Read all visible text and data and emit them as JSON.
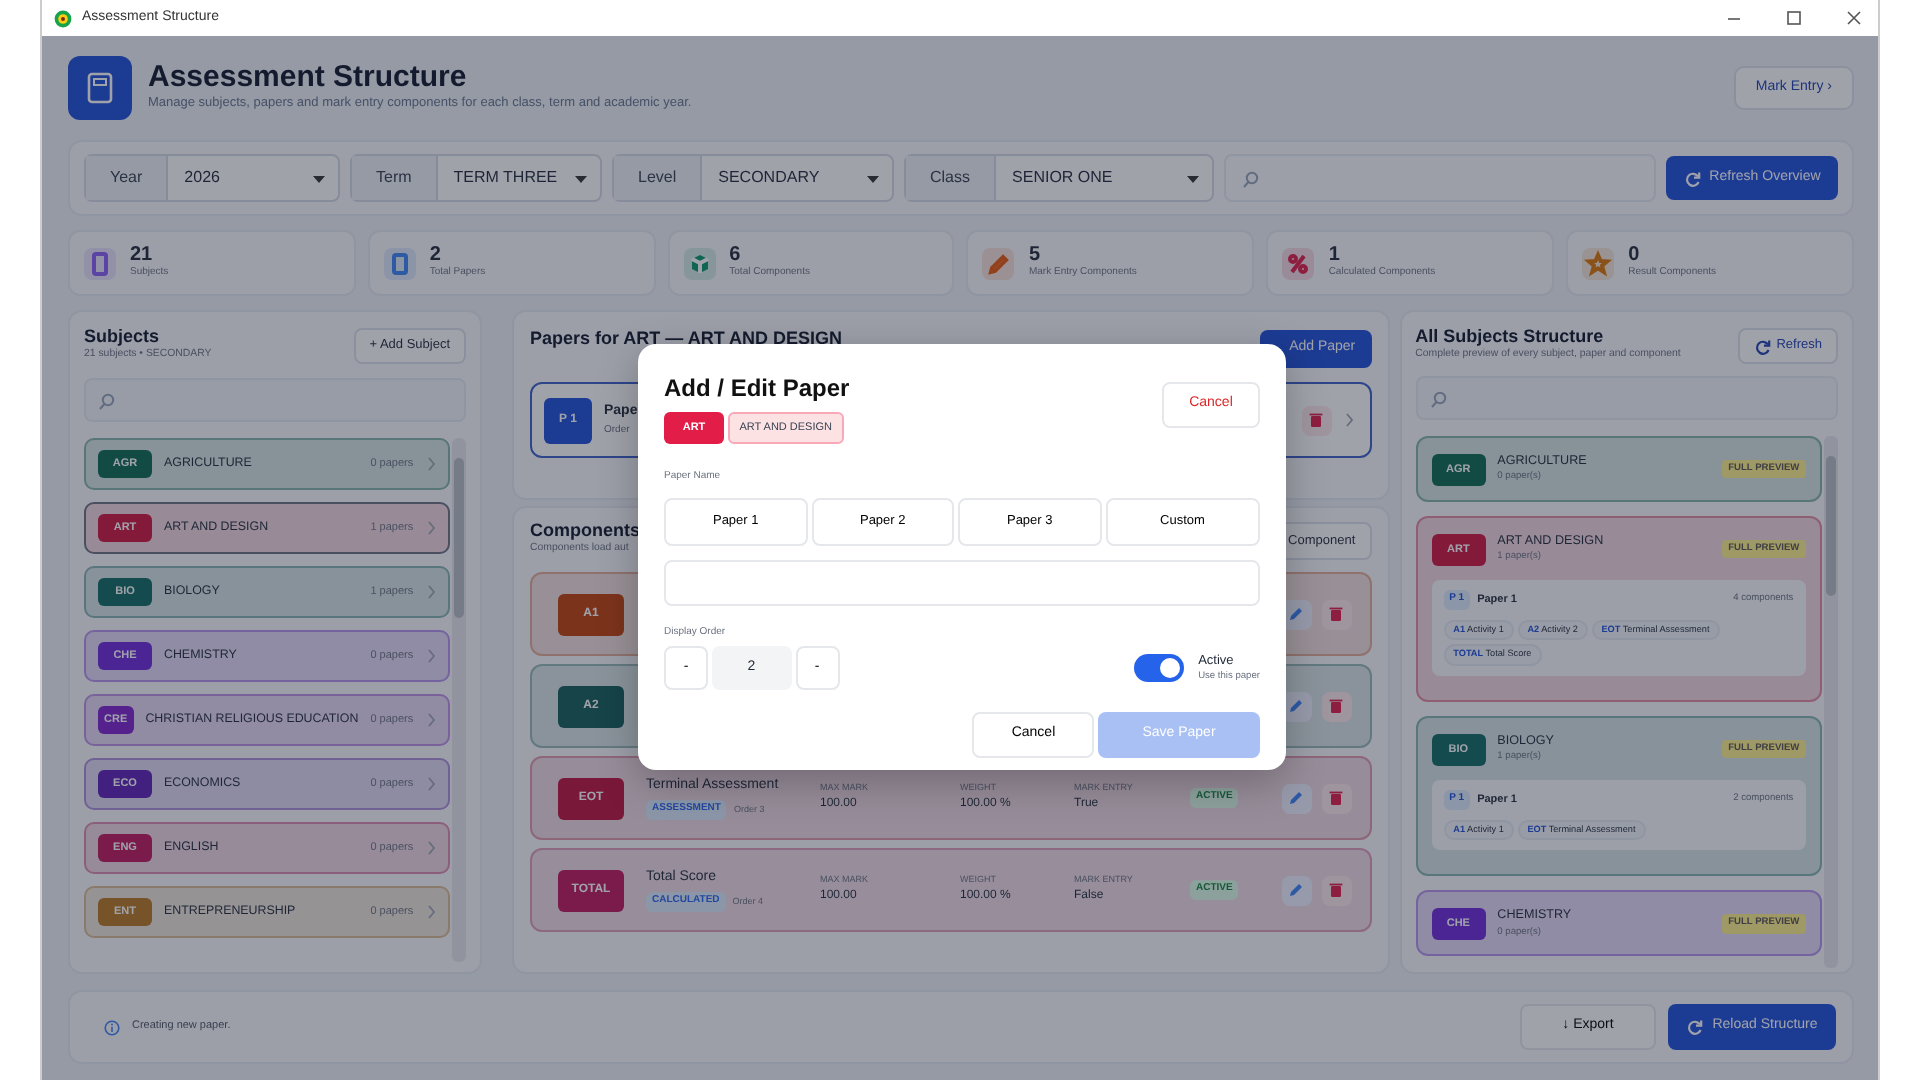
{
  "window": {
    "title": "Assessment Structure"
  },
  "header": {
    "title": "Assessment Structure",
    "subtitle": "Manage subjects, papers and mark entry components for each class, term and academic year.",
    "mark_entry_button": "Mark Entry ›"
  },
  "filters": [
    {
      "label": "Year",
      "value": "2026"
    },
    {
      "label": "Term",
      "value": "TERM THREE"
    },
    {
      "label": "Level",
      "value": "SECONDARY"
    },
    {
      "label": "Class",
      "value": "SENIOR ONE"
    }
  ],
  "refresh_button": "Refresh Overview",
  "stats": [
    {
      "kind": "subjects",
      "value": "21",
      "label": "Subjects",
      "color": "#5c44a4"
    },
    {
      "kind": "papers",
      "value": "2",
      "label": "Total Papers",
      "color": "#2e5aa4"
    },
    {
      "kind": "components",
      "value": "6",
      "label": "Total Components",
      "color": "#0f6553"
    },
    {
      "kind": "entry",
      "value": "5",
      "label": "Mark Entry Components",
      "color": "#93411d"
    },
    {
      "kind": "calculated",
      "value": "1",
      "label": "Calculated Components",
      "color": "#8e1f40"
    },
    {
      "kind": "result",
      "value": "0",
      "label": "Result Components",
      "color": "#8a5319"
    }
  ],
  "subjects_panel": {
    "title": "Subjects",
    "subtitle": "21 subjects • SECONDARY",
    "add_button": "+ Add Subject",
    "items": [
      {
        "code": "AGR",
        "name": "AGRICULTURE",
        "count": "0 papers",
        "color": "#124c44",
        "selected": false
      },
      {
        "code": "ART",
        "name": "ART AND DESIGN",
        "count": "1 papers",
        "color": "#841b3a",
        "selected": true
      },
      {
        "code": "BIO",
        "name": "BIOLOGY",
        "count": "1 papers",
        "color": "#144c4f",
        "selected": false
      },
      {
        "code": "CHE",
        "name": "CHEMISTRY",
        "count": "0 papers",
        "color": "#4b2694",
        "selected": false
      },
      {
        "code": "CRE",
        "name": "CHRISTIAN RELIGIOUS EDUCATION",
        "count": "0 papers",
        "color": "#55228d",
        "selected": false
      },
      {
        "code": "ECO",
        "name": "ECONOMICS",
        "count": "0 papers",
        "color": "#41217f",
        "selected": false
      },
      {
        "code": "ENG",
        "name": "ENGLISH",
        "count": "0 papers",
        "color": "#7a1c4c",
        "selected": false
      },
      {
        "code": "ENT",
        "name": "ENTREPRENEURSHIP",
        "count": "0 papers",
        "color": "#765428",
        "selected": false
      }
    ]
  },
  "papers_panel": {
    "title": "Papers for  ART  —  ART AND DESIGN",
    "add_button": "Add Paper",
    "papers": [
      {
        "code": "P 1",
        "name": "Pape",
        "order": "Order",
        "selected": true
      }
    ]
  },
  "components_panel": {
    "title": "Components",
    "subtitle": "Components load aut",
    "add_button": "Component",
    "rows": [
      {
        "code": "A1",
        "color": "#7c341d"
      },
      {
        "code": "A2",
        "color": "#164549"
      },
      {
        "code": "EOT",
        "color": "#7a1939",
        "title": "Terminal Assessment",
        "type": "ASSESSMENT",
        "order": "Order 3",
        "max_label": "MAX MARK",
        "max": "100.00",
        "weight_label": "WEIGHT",
        "weight": "100.00 %",
        "entry_label": "MARK ENTRY",
        "entry": "True",
        "status": "ACTIVE"
      },
      {
        "code": "TOTAL",
        "color": "#7a1c4c",
        "title": "Total Score",
        "type": "CALCULATED",
        "order": "Order 4",
        "max_label": "MAX MARK",
        "max": "100.00",
        "weight_label": "WEIGHT",
        "weight": "100.00 %",
        "entry_label": "MARK ENTRY",
        "entry": "False",
        "status": "ACTIVE"
      }
    ]
  },
  "modal": {
    "title": "Add / Edit Paper",
    "code": "ART",
    "subject": "ART AND DESIGN",
    "cancel_top": "Cancel",
    "name_label": "Paper Name",
    "presets": [
      {
        "label": "Paper 1",
        "selected": false
      },
      {
        "label": "Paper 2",
        "selected": false
      },
      {
        "label": "Paper 3",
        "selected": false
      },
      {
        "label": "Custom",
        "selected": false
      }
    ],
    "order_label": "Display Order",
    "order_minus": "-",
    "order_value": "2",
    "order_plus": "-",
    "active": {
      "on": true,
      "label": "Active",
      "hint": "Use this paper"
    },
    "cancel_button": "Cancel",
    "save_button": {
      "label": "Save Paper",
      "disabled": true
    }
  },
  "structure_panel": {
    "title": "All Subjects Structure",
    "subtitle": "Complete preview of every subject, paper and component",
    "refresh_button": "Refresh",
    "subjects": [
      {
        "code": "AGR",
        "name": "AGRICULTURE",
        "count": "0 paper(s)",
        "color": "#124c44",
        "badge": "FULL PREVIEW"
      },
      {
        "code": "ART",
        "name": "ART AND DESIGN",
        "count": "1 paper(s)",
        "color": "#841b3a",
        "badge": "FULL PREVIEW",
        "papers": [
          {
            "code": "P 1",
            "name": "Paper 1",
            "count": "4 components",
            "components": [
              {
                "code": "A1",
                "name": "Activity 1"
              },
              {
                "code": "A2",
                "name": "Activity 2"
              },
              {
                "code": "EOT",
                "name": "Terminal Assessment"
              },
              {
                "code": "TOTAL",
                "name": "Total Score"
              }
            ]
          }
        ]
      },
      {
        "code": "BIO",
        "name": "BIOLOGY",
        "count": "1 paper(s)",
        "color": "#144c4f",
        "badge": "FULL PREVIEW",
        "papers": [
          {
            "code": "P 1",
            "name": "Paper 1",
            "count": "2 components",
            "components": [
              {
                "code": "A1",
                "name": "Activity 1"
              },
              {
                "code": "EOT",
                "name": "Terminal Assessment"
              }
            ]
          }
        ]
      },
      {
        "code": "CHE",
        "name": "CHEMISTRY",
        "count": "0 paper(s)",
        "color": "#4b2694",
        "badge": "FULL PREVIEW"
      }
    ]
  },
  "footer": {
    "status": "Creating new paper.",
    "export_button": "↓ Export",
    "reload_button": "Reload Structure"
  }
}
